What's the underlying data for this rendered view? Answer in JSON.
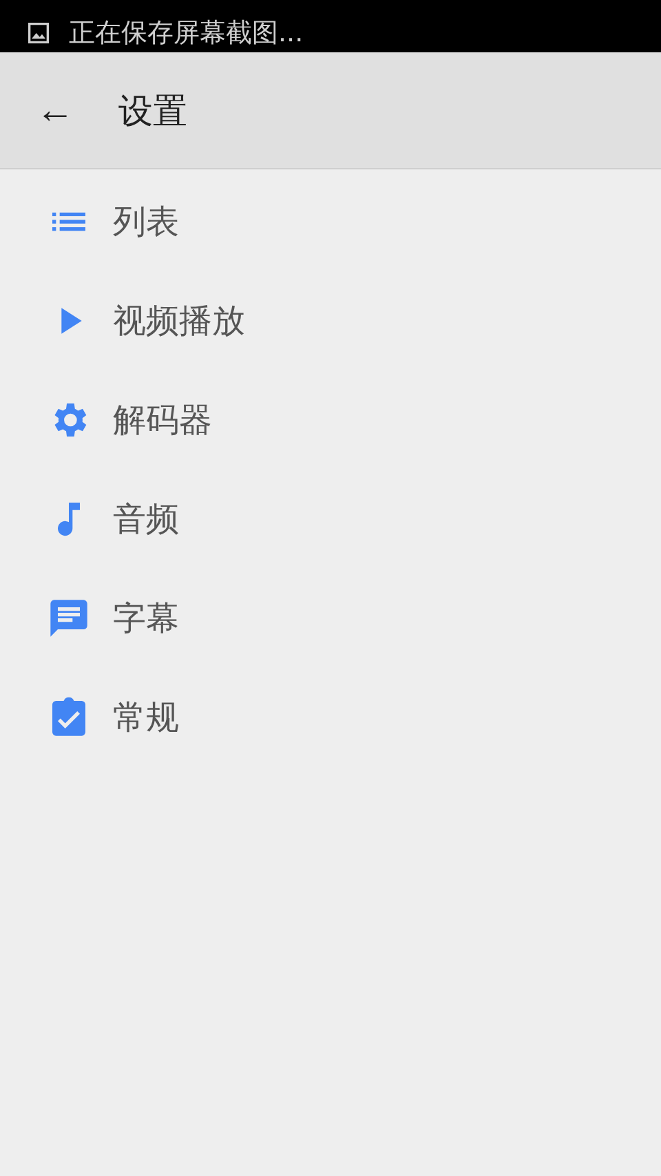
{
  "notification": {
    "text": "正在保存屏幕截图..."
  },
  "app_bar": {
    "back": "←",
    "title": "设置"
  },
  "items": [
    {
      "label": "列表",
      "kind": "list"
    },
    {
      "label": "视频播放",
      "kind": "play"
    },
    {
      "label": "解码器",
      "kind": "gear"
    },
    {
      "label": "音频",
      "kind": "note"
    },
    {
      "label": "字幕",
      "kind": "subtitle"
    },
    {
      "label": "常规",
      "kind": "clipboard"
    }
  ]
}
